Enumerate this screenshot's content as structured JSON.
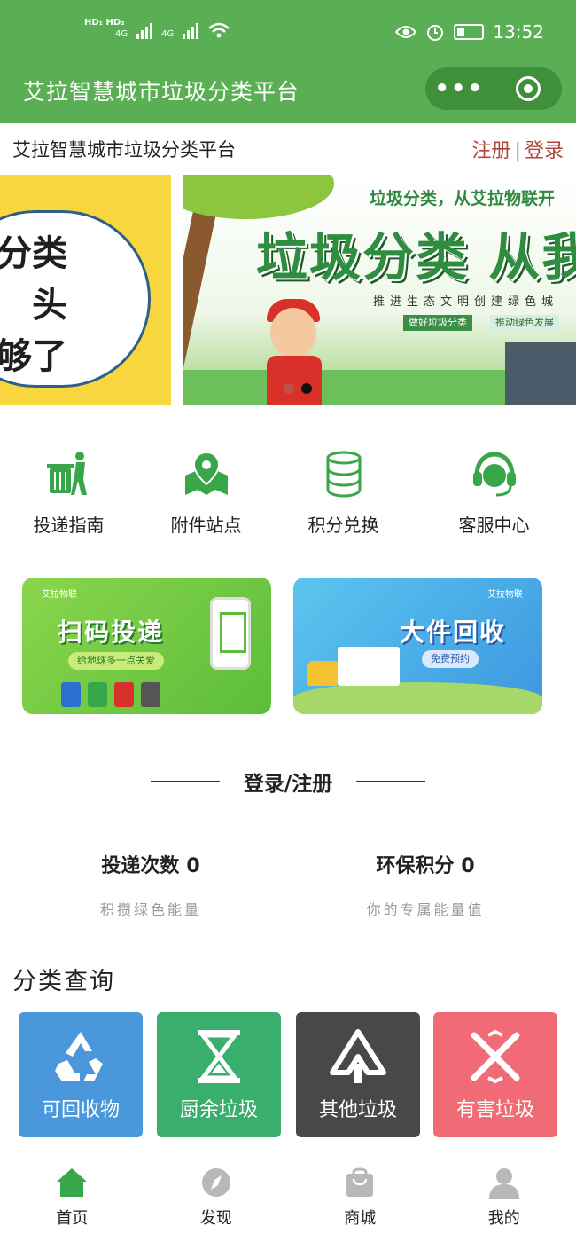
{
  "status_bar": {
    "signal_left": "HD₁ HD₂",
    "net1": "4G",
    "net2": "4G",
    "time": "13:52"
  },
  "app": {
    "title": "艾拉智慧城市垃圾分类平台",
    "capsule_more": "•••",
    "theme_color": "#5aae53"
  },
  "header": {
    "site_name": "艾拉智慧城市垃圾分类平台",
    "register": "注册",
    "divider": "|",
    "login": "登录"
  },
  "banners": {
    "left_text": [
      "分类",
      "头",
      "够了"
    ],
    "main_subtitle": "垃圾分类，从艾拉物联开",
    "main_title": "垃圾分类 从我",
    "main_line": "推进生态文明创建绿色城",
    "tag1": "做好垃圾分类",
    "tag2": "推动绿色发展"
  },
  "quick_nav": [
    {
      "label": "投递指南",
      "icon": "trash-person-icon"
    },
    {
      "label": "附件站点",
      "icon": "map-pin-icon"
    },
    {
      "label": "积分兑换",
      "icon": "coin-stack-icon"
    },
    {
      "label": "客服中心",
      "icon": "headset-icon"
    }
  ],
  "promos": {
    "scan": {
      "logo": "艾拉物联",
      "title": "扫码投递",
      "chip": "给地球多一点关爱"
    },
    "bulk": {
      "logo": "艾拉物联",
      "title": "大件回收",
      "chip": "免费预约"
    }
  },
  "login_section": {
    "title": "登录/注册"
  },
  "stats": {
    "deliveries": {
      "label": "投递次数",
      "value": "0",
      "sub": "积攒绿色能量"
    },
    "points": {
      "label": "环保积分",
      "value": "0",
      "sub": "你的专属能量值"
    }
  },
  "category": {
    "title": "分类查询",
    "items": [
      {
        "label": "可回收物",
        "color": "#4a97dc",
        "icon": "recycle-icon"
      },
      {
        "label": "厨余垃圾",
        "color": "#3aae6c",
        "icon": "hourglass-icon"
      },
      {
        "label": "其他垃圾",
        "color": "#484848",
        "icon": "triangle-arrow-icon"
      },
      {
        "label": "有害垃圾",
        "color": "#f06b76",
        "icon": "cross-icon"
      }
    ]
  },
  "tabbar": [
    {
      "label": "首页",
      "icon": "home-icon",
      "active": true
    },
    {
      "label": "发现",
      "icon": "compass-icon",
      "active": false
    },
    {
      "label": "商城",
      "icon": "bag-icon",
      "active": false
    },
    {
      "label": "我的",
      "icon": "user-icon",
      "active": false
    }
  ]
}
